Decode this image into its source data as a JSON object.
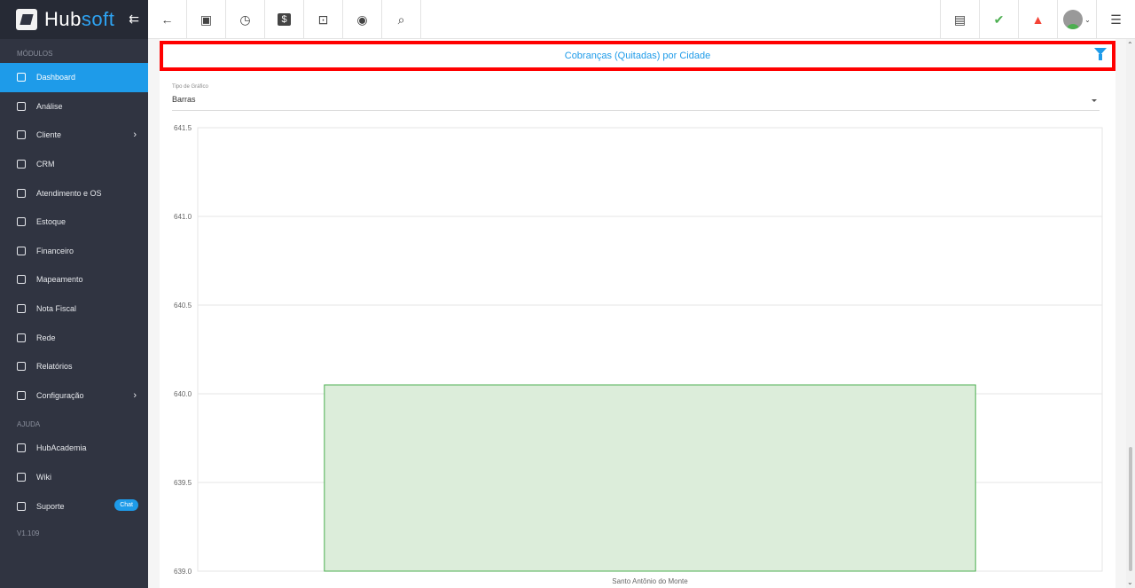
{
  "sidebar": {
    "brand": {
      "part1": "Hub",
      "part2": "soft"
    },
    "modules_label": "MÓDULOS",
    "help_label": "AJUDA",
    "items": [
      {
        "label": "Dashboard",
        "icon": "dashboard-icon",
        "active": true
      },
      {
        "label": "Análise",
        "icon": "chart-pie-icon"
      },
      {
        "label": "Cliente",
        "icon": "contact-card-icon",
        "chevron": "›"
      },
      {
        "label": "CRM",
        "icon": "trello-board-icon"
      },
      {
        "label": "Atendimento e OS",
        "icon": "calendar-clock-icon"
      },
      {
        "label": "Estoque",
        "icon": "box-icon"
      },
      {
        "label": "Financeiro",
        "icon": "money-icon"
      },
      {
        "label": "Mapeamento",
        "icon": "map-pin-icon"
      },
      {
        "label": "Nota Fiscal",
        "icon": "receipt-icon"
      },
      {
        "label": "Rede",
        "icon": "server-icon"
      },
      {
        "label": "Relatórios",
        "icon": "file-icon"
      },
      {
        "label": "Configuração",
        "icon": "gear-icon",
        "chevron": "›"
      }
    ],
    "help_items": [
      {
        "label": "HubAcademia",
        "icon": "video-icon"
      },
      {
        "label": "Wiki",
        "icon": "wikipedia-icon"
      },
      {
        "label": "Suporte",
        "icon": "chat-icon",
        "badge": "Chat"
      }
    ],
    "version": "V1.109"
  },
  "topbar": {
    "left_icons": [
      "back-arrow-icon",
      "contact-icon",
      "calendar-clock-icon",
      "dollar-icon",
      "terminal-icon",
      "eye-icon",
      "search-icon"
    ],
    "right_icons": [
      "pdf-icon",
      "chat-check-icon",
      "alarm-bell-icon",
      "avatar",
      "menu-list-icon"
    ]
  },
  "panel": {
    "title": "Cobranças (Quitadas) por Cidade",
    "chart_type_label": "Tipo de Gráfico",
    "chart_type_value": "Barras"
  },
  "chart_data": {
    "type": "bar",
    "categories": [
      "Santo Antônio do Monte"
    ],
    "values": [
      640.05
    ],
    "ylim": [
      639.0,
      641.5
    ],
    "yticks": [
      "641.5",
      "641.0",
      "640.5",
      "640.0",
      "639.5",
      "639.0"
    ],
    "grid": true,
    "bar_fill": "#dcedda",
    "bar_stroke": "#4caf50"
  }
}
